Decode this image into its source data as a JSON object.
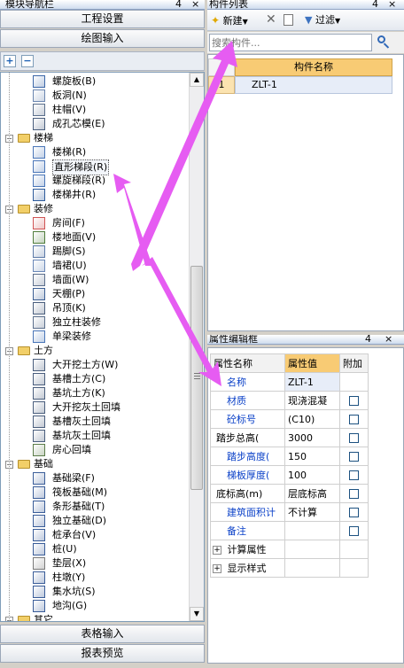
{
  "nav": {
    "title": "模块导航栏",
    "pin_glyph": "4",
    "close_glyph": "×",
    "btn_settings": "工程设置",
    "btn_drawing": "绘图输入",
    "btn_table": "表格输入",
    "btn_report": "报表预览",
    "plus": "+",
    "minus": "−",
    "items": [
      {
        "label": "螺旋板(B)"
      },
      {
        "label": "板洞(N)"
      },
      {
        "label": "柱帽(V)"
      },
      {
        "label": "成孔芯模(E)"
      },
      {
        "label": "楼梯"
      },
      {
        "label": "楼梯(R)"
      },
      {
        "label": "直形梯段(R)"
      },
      {
        "label": "螺旋梯段(R)"
      },
      {
        "label": "楼梯井(R)"
      },
      {
        "label": "装修"
      },
      {
        "label": "房间(F)"
      },
      {
        "label": "楼地面(V)"
      },
      {
        "label": "踢脚(S)"
      },
      {
        "label": "墙裙(U)"
      },
      {
        "label": "墙面(W)"
      },
      {
        "label": "天棚(P)"
      },
      {
        "label": "吊顶(K)"
      },
      {
        "label": "独立柱装修"
      },
      {
        "label": "单梁装修"
      },
      {
        "label": "土方"
      },
      {
        "label": "大开挖土方(W)"
      },
      {
        "label": "基槽土方(C)"
      },
      {
        "label": "基坑土方(K)"
      },
      {
        "label": "大开挖灰土回填"
      },
      {
        "label": "基槽灰土回填"
      },
      {
        "label": "基坑灰土回填"
      },
      {
        "label": "房心回填"
      },
      {
        "label": "基础"
      },
      {
        "label": "基础梁(F)"
      },
      {
        "label": "筏板基础(M)"
      },
      {
        "label": "条形基础(T)"
      },
      {
        "label": "独立基础(D)"
      },
      {
        "label": "桩承台(V)"
      },
      {
        "label": "桩(U)"
      },
      {
        "label": "垫层(X)"
      },
      {
        "label": "柱墩(Y)"
      },
      {
        "label": "集水坑(S)"
      },
      {
        "label": "地沟(G)"
      },
      {
        "label": "其它"
      }
    ]
  },
  "list": {
    "title": "构件列表",
    "new_label": "新建",
    "filter_label": "过滤",
    "search_placeholder": "搜索构件...",
    "col_name": "构件名称",
    "rows": [
      {
        "num": "1",
        "name": "ZLT-1"
      }
    ]
  },
  "props": {
    "title": "属性编辑框",
    "col_name": "属性名称",
    "col_value": "属性值",
    "col_extra": "附加",
    "rows": [
      {
        "name": "名称",
        "value": "ZLT-1",
        "link": true,
        "check": false
      },
      {
        "name": "材质",
        "value": "现浇混凝",
        "link": true,
        "check": true
      },
      {
        "name": "砼标号",
        "value": "(C10)",
        "link": true,
        "check": true
      },
      {
        "name": "踏步总高(",
        "value": "3000",
        "link": false,
        "check": true
      },
      {
        "name": "踏步高度(",
        "value": "150",
        "link": true,
        "check": true
      },
      {
        "name": "梯板厚度(",
        "value": "100",
        "link": true,
        "check": true
      },
      {
        "name": "底标高(m)",
        "value": "层底标高",
        "link": false,
        "check": true
      },
      {
        "name": "建筑面积计",
        "value": "不计算",
        "link": true,
        "check": true
      },
      {
        "name": "备注",
        "value": "",
        "link": true,
        "check": true
      }
    ],
    "group_calc": "计算属性",
    "group_display": "显示样式",
    "expand_glyph": "+"
  },
  "colors": {
    "link": "#0b41c8",
    "header_orange": "#f8cb74",
    "selection": "#e7edf8",
    "arrow": "#e65cf2"
  }
}
